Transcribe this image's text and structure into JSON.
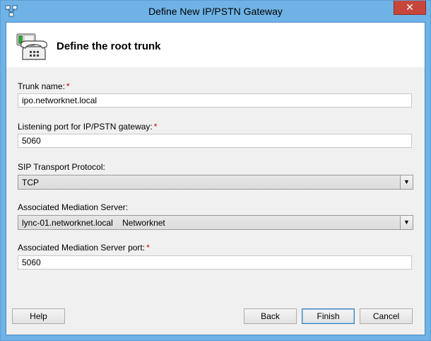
{
  "window": {
    "title": "Define New IP/PSTN Gateway",
    "close_glyph": "✕",
    "app_icon": "topology-builder-icon"
  },
  "header": {
    "title": "Define the root trunk",
    "icon": "phone-gateway-icon"
  },
  "fields": {
    "trunk_name": {
      "label": "Trunk name:",
      "required_mark": "*",
      "value": "ipo.networknet.local"
    },
    "listening_port": {
      "label": "Listening port for IP/PSTN gateway:",
      "required_mark": "*",
      "value": "5060"
    },
    "sip_protocol": {
      "label": "SIP Transport Protocol:",
      "selected": "TCP"
    },
    "mediation_server": {
      "label": "Associated Mediation Server:",
      "selected": "lync-01.networknet.local    Networknet"
    },
    "mediation_port": {
      "label": "Associated Mediation Server port:",
      "required_mark": "*",
      "value": "5060"
    }
  },
  "buttons": {
    "help": "Help",
    "back": "Back",
    "finish": "Finish",
    "cancel": "Cancel"
  },
  "colors": {
    "titlebar": "#6fb3e6",
    "close": "#c7463c",
    "required": "#cc0000"
  }
}
